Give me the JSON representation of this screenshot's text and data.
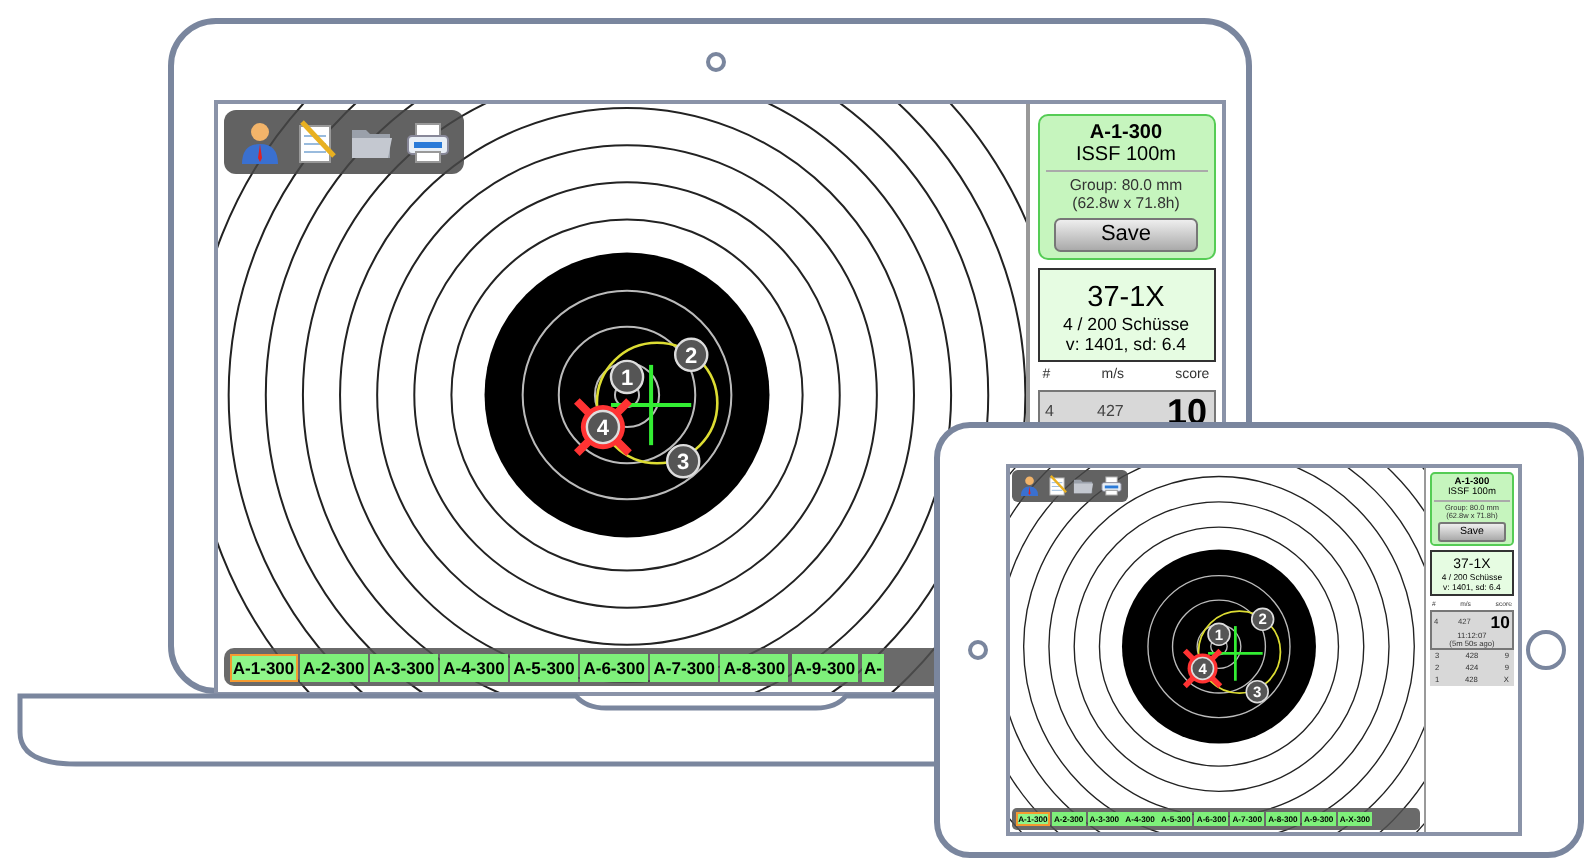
{
  "laptop": {
    "screen": {
      "target": {
        "shots": [
          {
            "label": "1",
            "selected": false
          },
          {
            "label": "2",
            "selected": false
          },
          {
            "label": "3",
            "selected": false
          },
          {
            "label": "4",
            "selected": true
          }
        ]
      },
      "sidebar": {
        "title": "A-1-300",
        "discipline": "ISSF 100m",
        "group": "Group: 80.0 mm",
        "group_size": "(62.8w x 71.8h)",
        "save_button": "Save",
        "score": "37-1X",
        "shot_count": "4 / 200 Schüsse",
        "velocity": "v: 1401, sd: 6.4",
        "columns": [
          "#",
          "m/s",
          "score"
        ],
        "latest": {
          "number": "4",
          "speed": "427",
          "score": "10"
        }
      },
      "tabs": [
        {
          "label": "A-1-300",
          "selected": true
        },
        {
          "label": "A-2-300",
          "selected": false
        },
        {
          "label": "A-3-300",
          "selected": false
        },
        {
          "label": "A-4-300",
          "selected": false
        },
        {
          "label": "A-5-300",
          "selected": false
        },
        {
          "label": "A-6-300",
          "selected": false
        },
        {
          "label": "A-7-300",
          "selected": false
        },
        {
          "label": "A-8-300",
          "selected": false
        },
        {
          "label": "A-9-300",
          "selected": false
        },
        {
          "label": "A-",
          "selected": false
        }
      ]
    }
  },
  "tablet": {
    "screen": {
      "target": {
        "shots": [
          {
            "label": "1",
            "selected": false
          },
          {
            "label": "2",
            "selected": false
          },
          {
            "label": "3",
            "selected": false
          },
          {
            "label": "4",
            "selected": true
          }
        ]
      },
      "sidebar": {
        "title": "A-1-300",
        "discipline": "ISSF 100m",
        "group": "Group: 80.0 mm",
        "group_size": "(62.8w x 71.8h)",
        "save_button": "Save",
        "score": "37-1X",
        "shot_count": "4 / 200 Schüsse",
        "velocity": "v: 1401, sd: 6.4",
        "columns": [
          "#",
          "m/s",
          "score"
        ],
        "latest": {
          "number": "4",
          "speed": "427",
          "score": "10",
          "time": "11:12:07",
          "ago": "(5m 50s ago)"
        },
        "rows": [
          {
            "number": "3",
            "speed": "428",
            "score": "9"
          },
          {
            "number": "2",
            "speed": "424",
            "score": "9"
          },
          {
            "number": "1",
            "speed": "428",
            "score": "X"
          }
        ]
      },
      "tabs": [
        {
          "label": "A-1-300",
          "selected": true
        },
        {
          "label": "A-2-300",
          "selected": false
        },
        {
          "label": "A-3-300",
          "selected": false
        },
        {
          "label": "A-4-300",
          "selected": false
        },
        {
          "label": "A-5-300",
          "selected": false
        },
        {
          "label": "A-6-300",
          "selected": false
        },
        {
          "label": "A-7-300",
          "selected": false
        },
        {
          "label": "A-8-300",
          "selected": false
        },
        {
          "label": "A-9-300",
          "selected": false
        },
        {
          "label": "A-X-300",
          "selected": false
        }
      ]
    }
  }
}
